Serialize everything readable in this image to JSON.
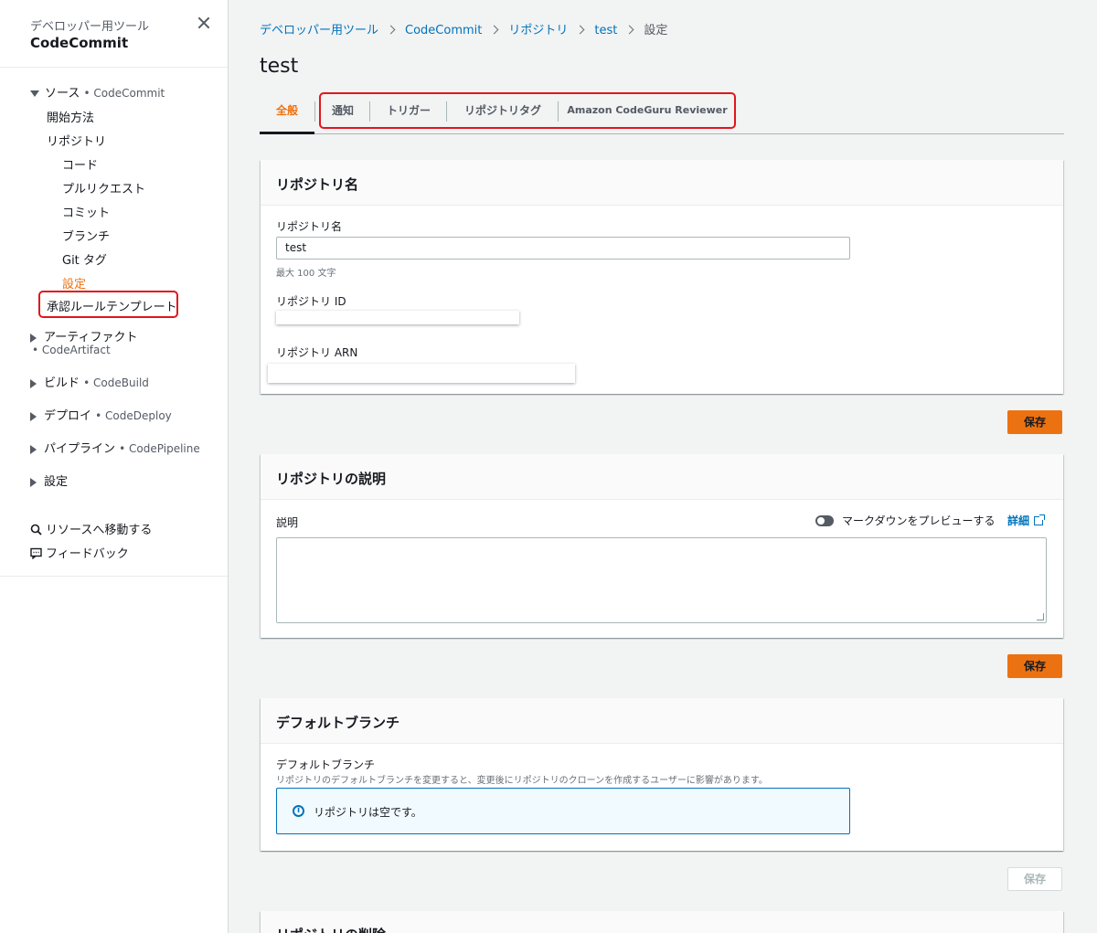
{
  "sidebar": {
    "super_title": "デベロッパー用ツール",
    "title": "CodeCommit",
    "source": {
      "label": "ソース",
      "service": "• CodeCommit"
    },
    "items": {
      "getting_started": "開始方法",
      "repositories": "リポジトリ",
      "code": "コード",
      "pull_requests": "プルリクエスト",
      "commits": "コミット",
      "branches": "ブランチ",
      "git_tags": "Git タグ",
      "settings": "設定",
      "approval_templates": "承認ルールテンプレート"
    },
    "artifact": {
      "label": "アーティファクト",
      "service": "• CodeArtifact"
    },
    "build": {
      "label": "ビルド",
      "service": "• CodeBuild"
    },
    "deploy": {
      "label": "デプロイ",
      "service": "• CodeDeploy"
    },
    "pipeline": {
      "label": "パイプライン",
      "service": "• CodePipeline"
    },
    "settings_section": "設定",
    "goto_resource": "リソースへ移動する",
    "feedback": "フィードバック"
  },
  "breadcrumb": {
    "items": [
      "デベロッパー用ツール",
      "CodeCommit",
      "リポジトリ",
      "test"
    ],
    "current": "設定"
  },
  "page": {
    "title": "test"
  },
  "tabs": {
    "general": "全般",
    "notifications": "通知",
    "triggers": "トリガー",
    "repo_tags": "リポジトリタグ",
    "codeguru": "Amazon CodeGuru Reviewer"
  },
  "repo_name_panel": {
    "heading": "リポジトリ名",
    "name_label": "リポジトリ名",
    "name_value": "test",
    "name_hint": "最大 100 文字",
    "id_label": "リポジトリ ID",
    "arn_label": "リポジトリ ARN"
  },
  "description_panel": {
    "heading": "リポジトリの説明",
    "label": "説明",
    "preview_toggle": "マークダウンをプレビューする",
    "details_link": "詳細"
  },
  "default_branch_panel": {
    "heading": "デフォルトブランチ",
    "label": "デフォルトブランチ",
    "hint": "リポジトリのデフォルトブランチを変更すると、変更後にリポジトリのクローンを作成するユーザーに影響があります。",
    "info": "リポジトリは空です。"
  },
  "delete_panel": {
    "heading": "リポジトリの削除"
  },
  "buttons": {
    "save": "保存"
  },
  "colors": {
    "accent": "#ec7211",
    "link": "#0073bb",
    "highlight": "#e0161c"
  }
}
